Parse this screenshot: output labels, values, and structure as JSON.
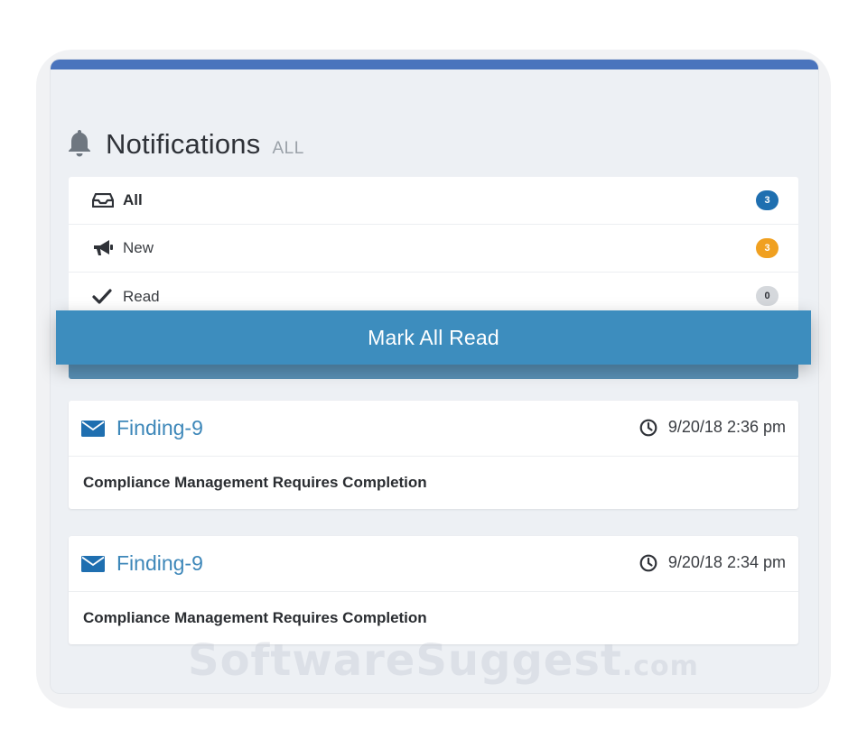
{
  "header": {
    "title": "Notifications",
    "subtitle": "ALL",
    "icon": "bell-icon"
  },
  "filters": [
    {
      "label": "All",
      "count": "3",
      "icon": "inbox-icon",
      "badge_color": "#1f6fb0"
    },
    {
      "label": "New",
      "count": "3",
      "icon": "megaphone-icon",
      "badge_color": "#f0a020"
    },
    {
      "label": "Read",
      "count": "0",
      "icon": "checkmark-icon",
      "badge_color": "#d5d8dc"
    }
  ],
  "actions": {
    "mark_all_read": "Mark All Read"
  },
  "notifications": [
    {
      "title": "Finding-9",
      "time": "9/20/18 2:36 pm",
      "message": "Compliance Management Requires Completion"
    },
    {
      "title": "Finding-9",
      "time": "9/20/18 2:34 pm",
      "message": "Compliance Management Requires Completion"
    }
  ],
  "watermark": {
    "brand": "SoftwareSuggest",
    "suffix": ".com"
  },
  "colors": {
    "accent": "#3d8dbe",
    "topbar": "#4a74bd",
    "link": "#3d87b9"
  }
}
